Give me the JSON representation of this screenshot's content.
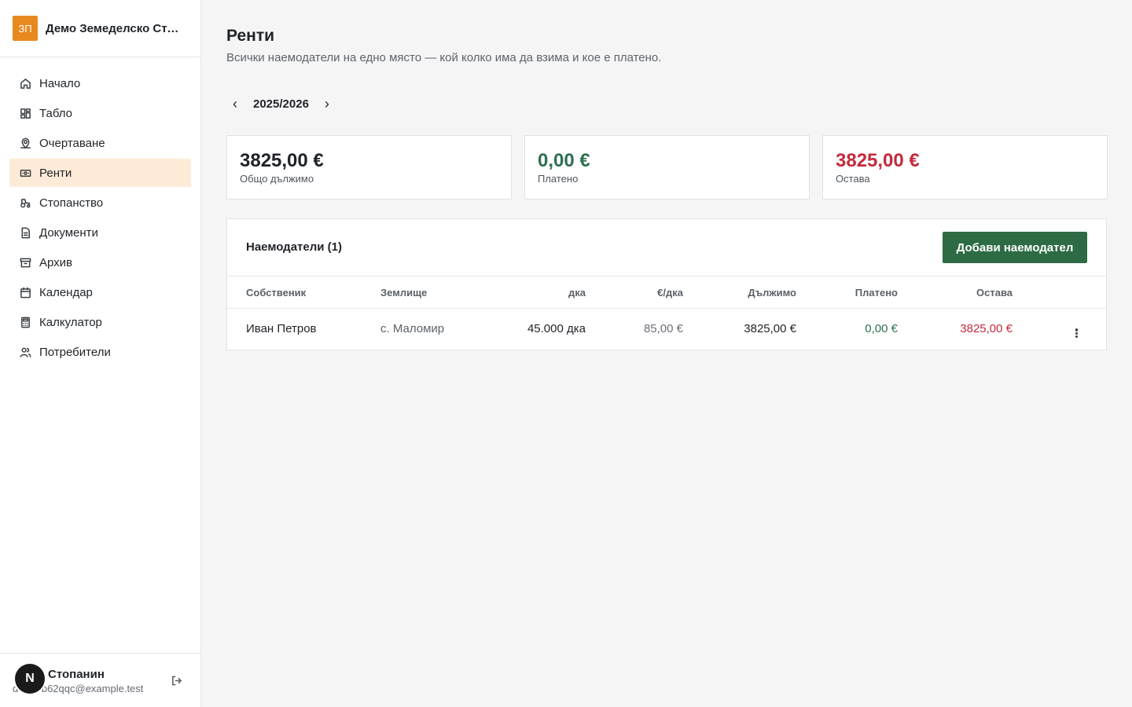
{
  "brand": {
    "logo_text": "ЗП",
    "name": "Демо Земеделско Стопанство"
  },
  "nav": [
    {
      "label": "Начало",
      "icon": "home-icon"
    },
    {
      "label": "Табло",
      "icon": "dashboard-icon"
    },
    {
      "label": "Очертаване",
      "icon": "map-pin-icon"
    },
    {
      "label": "Ренти",
      "icon": "banknote-icon",
      "active": true
    },
    {
      "label": "Стопанство",
      "icon": "tractor-icon"
    },
    {
      "label": "Документи",
      "icon": "document-icon"
    },
    {
      "label": "Архив",
      "icon": "archive-icon"
    },
    {
      "label": "Календар",
      "icon": "calendar-icon"
    },
    {
      "label": "Калкулатор",
      "icon": "calculator-icon"
    },
    {
      "label": "Потребители",
      "icon": "users-icon"
    }
  ],
  "user": {
    "name": "Стопанин",
    "email": "demo-b62qqc@example.test",
    "badge": "N"
  },
  "page": {
    "title": "Ренти",
    "subtitle": "Всички наемодатели на едно място — кой колко има да взима и кое е платено."
  },
  "season": {
    "label": "2025/2026",
    "prev": "‹",
    "next": "›"
  },
  "stats": {
    "total": {
      "value": "3825,00 €",
      "label": "Общо дължимо"
    },
    "paid": {
      "value": "0,00 €",
      "label": "Платено"
    },
    "remaining": {
      "value": "3825,00 €",
      "label": "Остава"
    }
  },
  "colors": {
    "accent": "#e8891f",
    "primary": "#2d6b45",
    "paid": "#2e7050",
    "remaining": "#c4293b",
    "active_bg": "#fdebd7"
  },
  "table": {
    "title": "Наемодатели (1)",
    "add_button": "Добави наемодател",
    "columns": {
      "owner": "Собственик",
      "land": "Землище",
      "dka": "дка",
      "rate": "€/дка",
      "due": "Дължимо",
      "paid": "Платено",
      "remaining": "Остава"
    },
    "rows": [
      {
        "owner": "Иван Петров",
        "land": "с. Маломир",
        "dka": "45.000 дка",
        "rate": "85,00 €",
        "due": "3825,00 €",
        "paid": "0,00 €",
        "remaining": "3825,00 €"
      }
    ]
  }
}
